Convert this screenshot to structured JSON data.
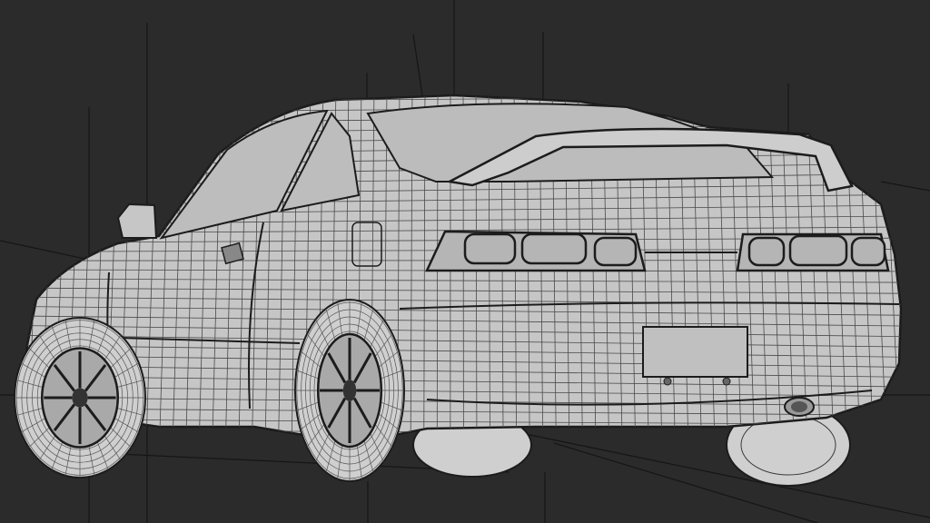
{
  "viewport": {
    "background": "#2b2b2b",
    "wire_color": "#1c1c1c",
    "surface_color": "#c8c8c8",
    "guide_color": "#141414"
  }
}
